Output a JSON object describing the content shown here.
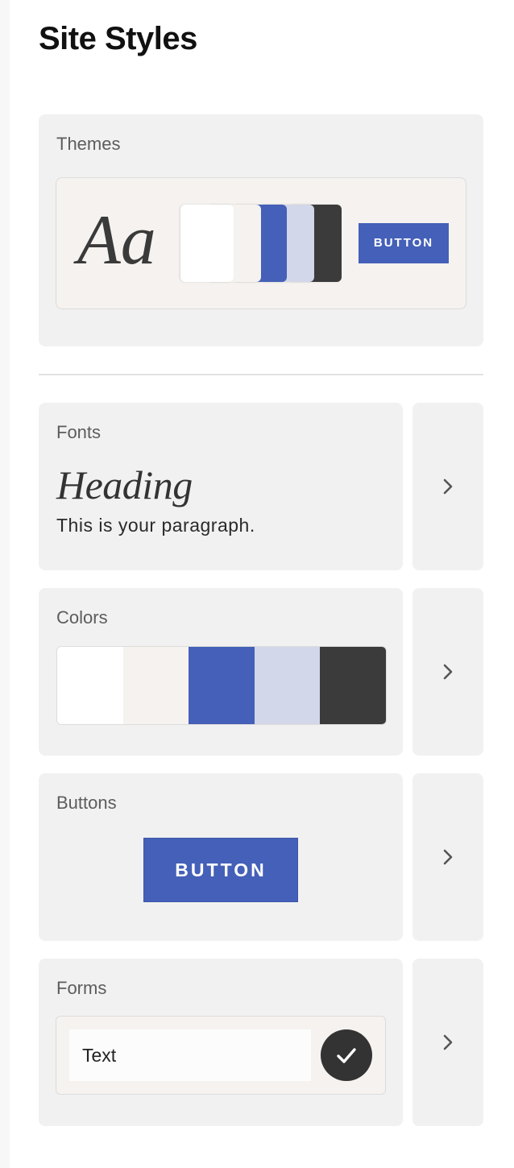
{
  "page": {
    "title": "Site Styles"
  },
  "themes": {
    "label": "Themes",
    "preview_glyph": "Aa",
    "button_label": "BUTTON"
  },
  "fonts": {
    "label": "Fonts",
    "heading_sample": "Heading",
    "paragraph_sample": "This is your paragraph."
  },
  "colors": {
    "label": "Colors",
    "palette": [
      "#ffffff",
      "#f5f2ef",
      "#4460b8",
      "#d2d7e9",
      "#3b3b3b"
    ]
  },
  "buttons": {
    "label": "Buttons",
    "button_label": "BUTTON"
  },
  "forms": {
    "label": "Forms",
    "input_value": "Text"
  },
  "icons": {
    "chevron": "chevron-right-icon",
    "check": "checkmark-icon"
  }
}
